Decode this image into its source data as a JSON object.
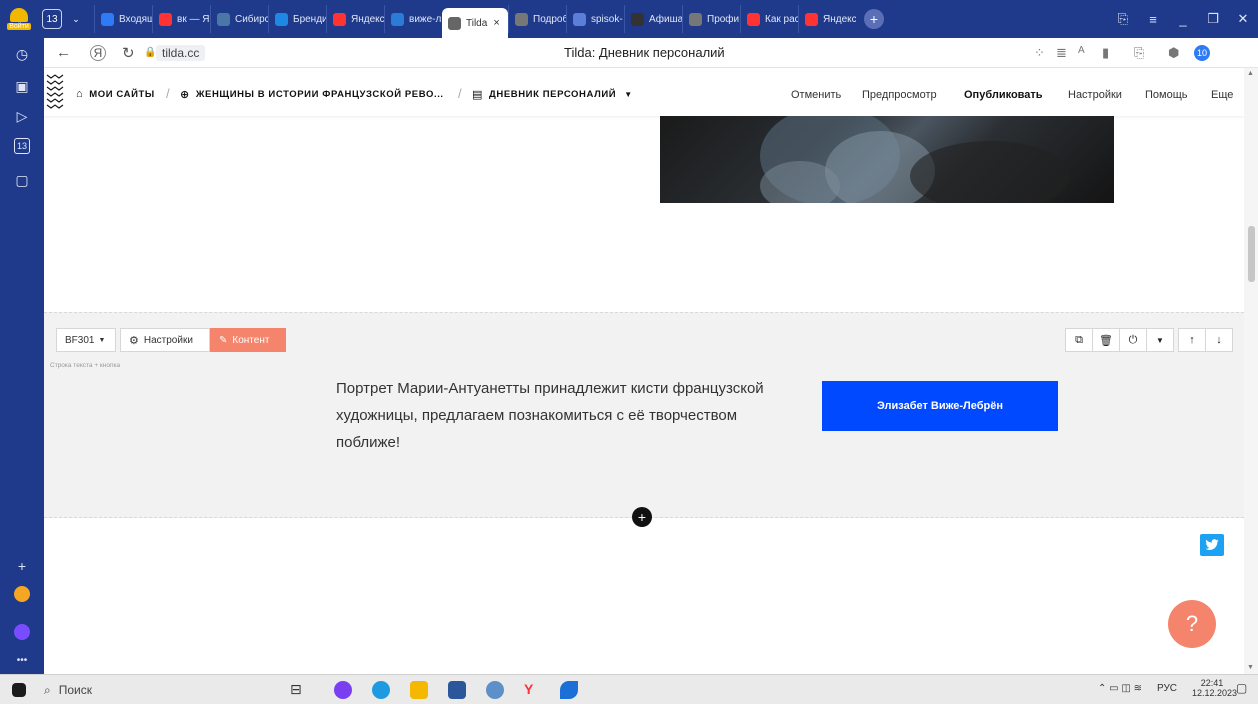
{
  "browser": {
    "login_label": "Войти",
    "tab_counter": "13",
    "tabs": [
      {
        "label": "Входящ",
        "color": "#2f7bf5"
      },
      {
        "label": "вк — Я",
        "color": "#f33"
      },
      {
        "label": "Сибирс",
        "color": "#4a76a8"
      },
      {
        "label": "Бренди",
        "color": "#1e88e5"
      },
      {
        "label": "Яндекс",
        "color": "#f33"
      },
      {
        "label": "виже-л",
        "color": "#2b7bd8"
      },
      {
        "label": "Tilda",
        "color": "#666",
        "active": true
      },
      {
        "label": "Подроб",
        "color": "#777"
      },
      {
        "label": "spisok-",
        "color": "#5b7fd8"
      },
      {
        "label": "Афиша",
        "color": "#333"
      },
      {
        "label": "Профи",
        "color": "#777"
      },
      {
        "label": "Как рас",
        "color": "#f33"
      },
      {
        "label": "Яндекс",
        "color": "#f33"
      }
    ],
    "domain": "tilda.cc",
    "page_title": "Tilda: Дневник персоналий",
    "download_badge": "10"
  },
  "tilda": {
    "breadcrumbs": [
      {
        "label": "МОИ САЙТЫ",
        "icon": "home-icon"
      },
      {
        "label": "ЖЕНЩИНЫ В ИСТОРИИ ФРАНЦУЗСКОЙ РЕВО...",
        "icon": "globe-icon"
      },
      {
        "label": "ДНЕВНИК ПЕРСОНАЛИЙ",
        "icon": "page-icon"
      }
    ],
    "menu": {
      "cancel": "Отменить",
      "preview": "Предпросмотр",
      "publish": "Опубликовать",
      "settings": "Настройки",
      "help": "Помощь",
      "more": "Еще"
    }
  },
  "block": {
    "code": "BF301",
    "settings_label": "Настройки",
    "content_label": "Контент",
    "type_label": "Строка текста + кнопка",
    "text": "Портрет Марии-Антуанетты принадлежит кисти французской художницы, предлагаем познакомиться с её творчеством поближе!",
    "button_label": "Элизабет Виже-Лебрён"
  },
  "taskbar": {
    "search_placeholder": "Поиск",
    "lang": "РУС",
    "time": "22:41",
    "date": "12.12.2023"
  },
  "colors": {
    "accent": "#f4846b",
    "button": "#0049ff",
    "browser_frame": "#1f3a8a"
  }
}
